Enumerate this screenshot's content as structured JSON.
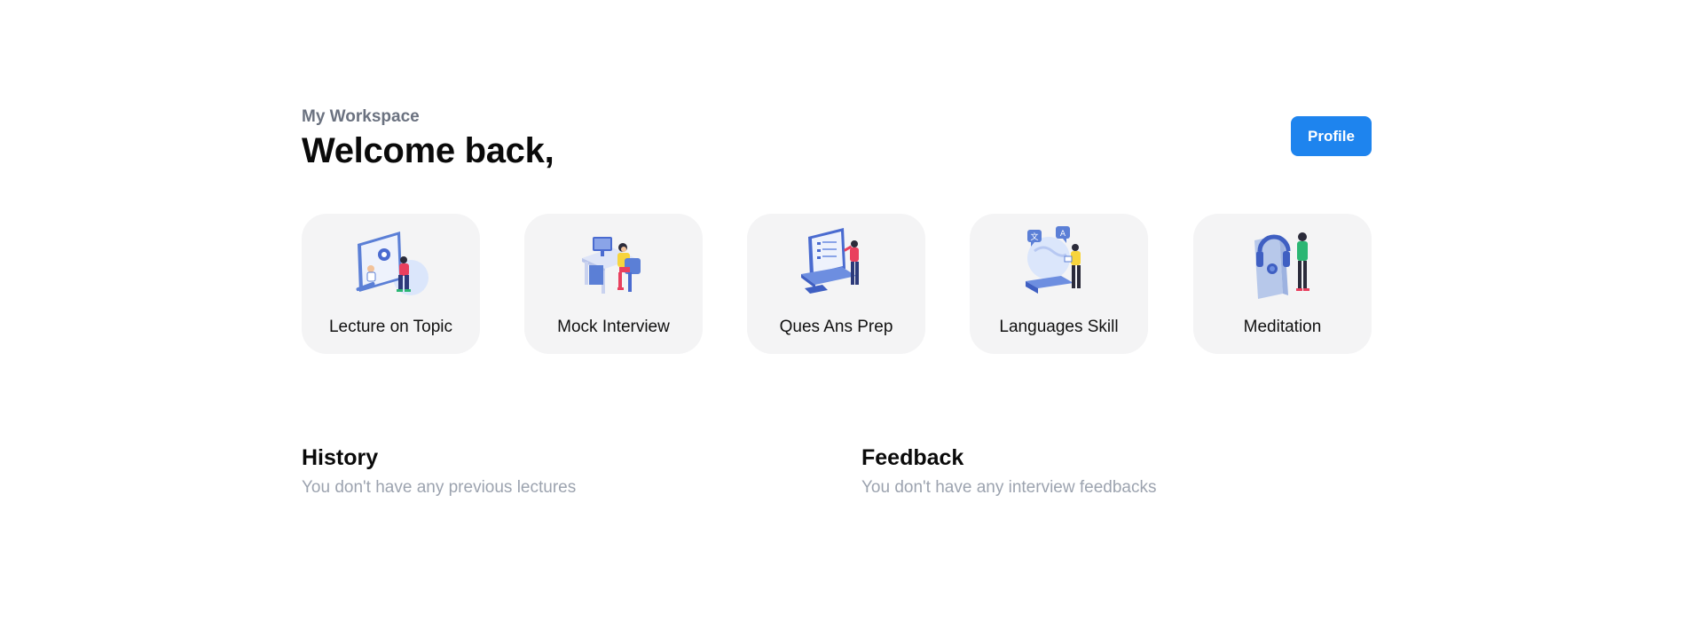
{
  "header": {
    "subtitle": "My Workspace",
    "title": "Welcome back,",
    "profile_label": "Profile"
  },
  "cards": [
    {
      "label": "Lecture on Topic",
      "icon": "lecture-illustration-icon"
    },
    {
      "label": "Mock Interview",
      "icon": "interview-illustration-icon"
    },
    {
      "label": "Ques Ans Prep",
      "icon": "qa-prep-illustration-icon"
    },
    {
      "label": "Languages Skill",
      "icon": "languages-illustration-icon"
    },
    {
      "label": "Meditation",
      "icon": "meditation-illustration-icon"
    }
  ],
  "history": {
    "title": "History",
    "empty_text": "You don't have any previous lectures"
  },
  "feedback": {
    "title": "Feedback",
    "empty_text": "You don't have any interview feedbacks"
  },
  "colors": {
    "accent": "#1e84ee",
    "card_bg": "#f4f4f5",
    "muted_text": "#9ca3af"
  }
}
